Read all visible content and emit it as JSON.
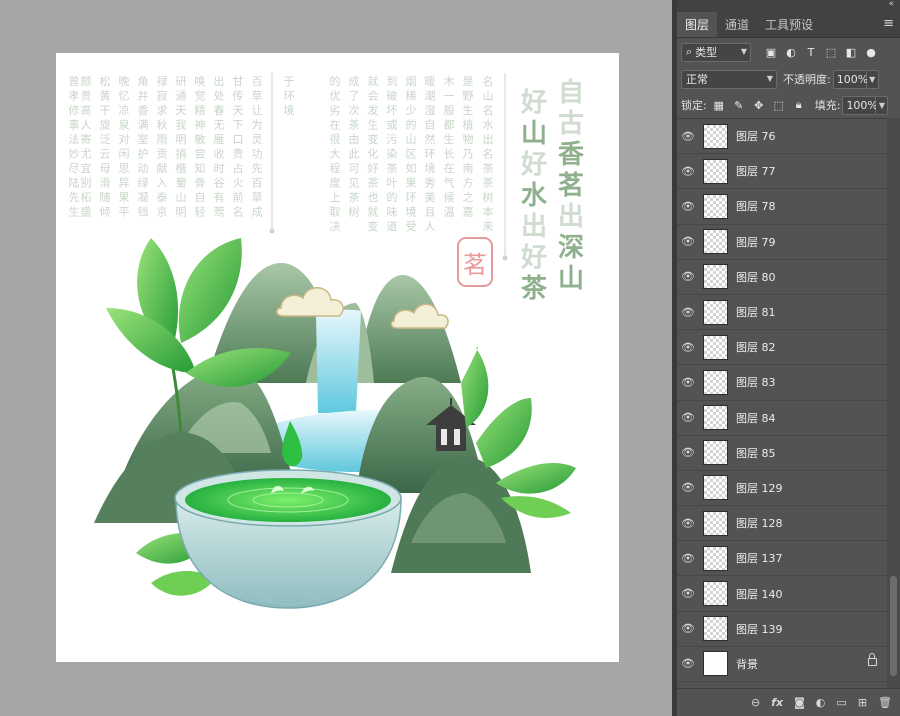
{
  "panel": {
    "tabs": [
      {
        "label": "图层",
        "active": true
      },
      {
        "label": "通道",
        "active": false
      },
      {
        "label": "工具预设",
        "active": false
      }
    ],
    "filter_kind": "类型",
    "blend_mode": "正常",
    "opacity_label": "不透明度:",
    "opacity_value": "100%",
    "lock_label": "锁定:",
    "fill_label": "填充:",
    "fill_value": "100%",
    "layers": [
      {
        "name": "图层 76",
        "visible": true,
        "locked": false
      },
      {
        "name": "图层 77",
        "visible": true,
        "locked": false
      },
      {
        "name": "图层 78",
        "visible": true,
        "locked": false
      },
      {
        "name": "图层 79",
        "visible": true,
        "locked": false
      },
      {
        "name": "图层 80",
        "visible": true,
        "locked": false
      },
      {
        "name": "图层 81",
        "visible": true,
        "locked": false
      },
      {
        "name": "图层 82",
        "visible": true,
        "locked": false
      },
      {
        "name": "图层 83",
        "visible": true,
        "locked": false
      },
      {
        "name": "图层 84",
        "visible": true,
        "locked": false
      },
      {
        "name": "图层 85",
        "visible": true,
        "locked": false
      },
      {
        "name": "图层 129",
        "visible": true,
        "locked": false
      },
      {
        "name": "图层 128",
        "visible": true,
        "locked": false
      },
      {
        "name": "图层 137",
        "visible": true,
        "locked": false
      },
      {
        "name": "图层 140",
        "visible": true,
        "locked": false
      },
      {
        "name": "图层 139",
        "visible": true,
        "locked": false
      },
      {
        "name": "背景",
        "visible": true,
        "locked": true
      }
    ],
    "footer_icons": [
      "link-icon",
      "fx-icon",
      "mask-icon",
      "adjustment-icon",
      "folder-icon",
      "new-layer-icon",
      "trash-icon"
    ]
  },
  "artwork": {
    "title_col1": "自古香茗出深山",
    "title_col2": "好山好水出好茶",
    "seal_text": "茗",
    "body_columns": [
      "名山名水出名茶茶树本来",
      "是野生植物乃南方之嘉",
      "木一般都生长在气候温",
      "暖潮湿自然环境秀美且人",
      "烟稀少的山区如果环境受",
      "到破坏或污染茶叶的味道",
      "就会发生变化好茶也就变",
      "成了次茶由此可见茶树",
      "的优劣在很大程度上取决",
      "于环境",
      "百草让为灵功先百草成",
      "甘传天下口贵占火前名",
      "出处春无雁收时谷有莺",
      "唤觉精神敏尝知骨自轻",
      "研通天我明捎楷蜀山明",
      "禄寂求秋雨贡献入泰京",
      "角并香满室护动绿凝铛",
      "晚忆凉泉对闲思异果平",
      "松黄干旋泛云母滑随倾",
      "颇贵高人寄尤宜别柘盛",
      "曾孝修事法妙尽陆先生"
    ]
  }
}
